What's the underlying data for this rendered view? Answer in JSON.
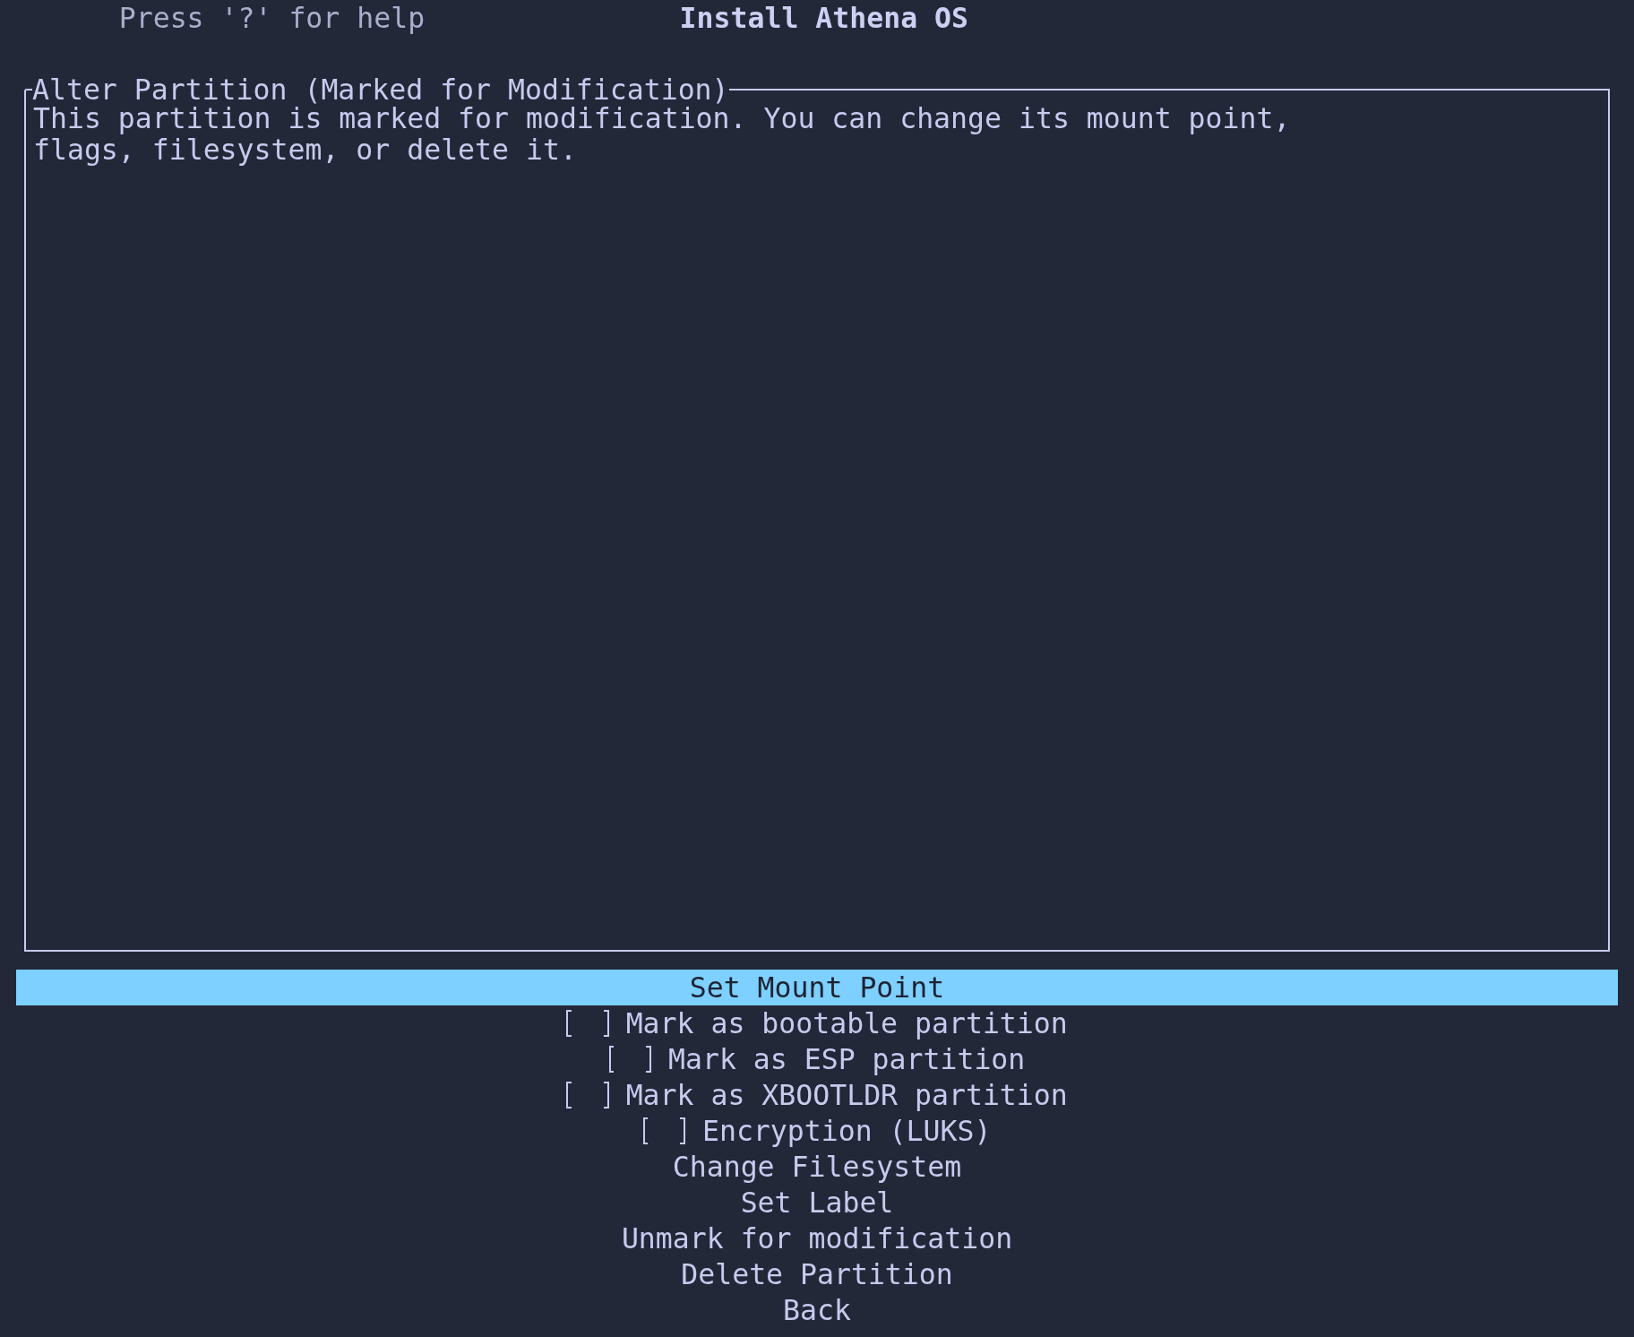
{
  "header": {
    "help": "Press '?' for help",
    "title": "Install Athena OS"
  },
  "panel": {
    "title": "Alter Partition (Marked for Modification)",
    "description": "This partition is marked for modification. You can change its mount point, flags, filesystem, or delete it."
  },
  "menu": [
    {
      "kind": "action",
      "label": "Set Mount Point",
      "selected": true
    },
    {
      "kind": "checkbox",
      "label": "Mark as bootable partition",
      "checked": false,
      "selected": false
    },
    {
      "kind": "checkbox",
      "label": "Mark as ESP partition",
      "checked": false,
      "selected": false
    },
    {
      "kind": "checkbox",
      "label": "Mark as XBOOTLDR partition",
      "checked": false,
      "selected": false
    },
    {
      "kind": "checkbox",
      "label": "Encryption (LUKS)",
      "checked": false,
      "selected": false
    },
    {
      "kind": "action",
      "label": "Change Filesystem",
      "selected": false
    },
    {
      "kind": "action",
      "label": "Set Label",
      "selected": false
    },
    {
      "kind": "action",
      "label": "Unmark for modification",
      "selected": false
    },
    {
      "kind": "action",
      "label": "Delete Partition",
      "selected": false
    },
    {
      "kind": "action",
      "label": "Back",
      "selected": false
    }
  ]
}
